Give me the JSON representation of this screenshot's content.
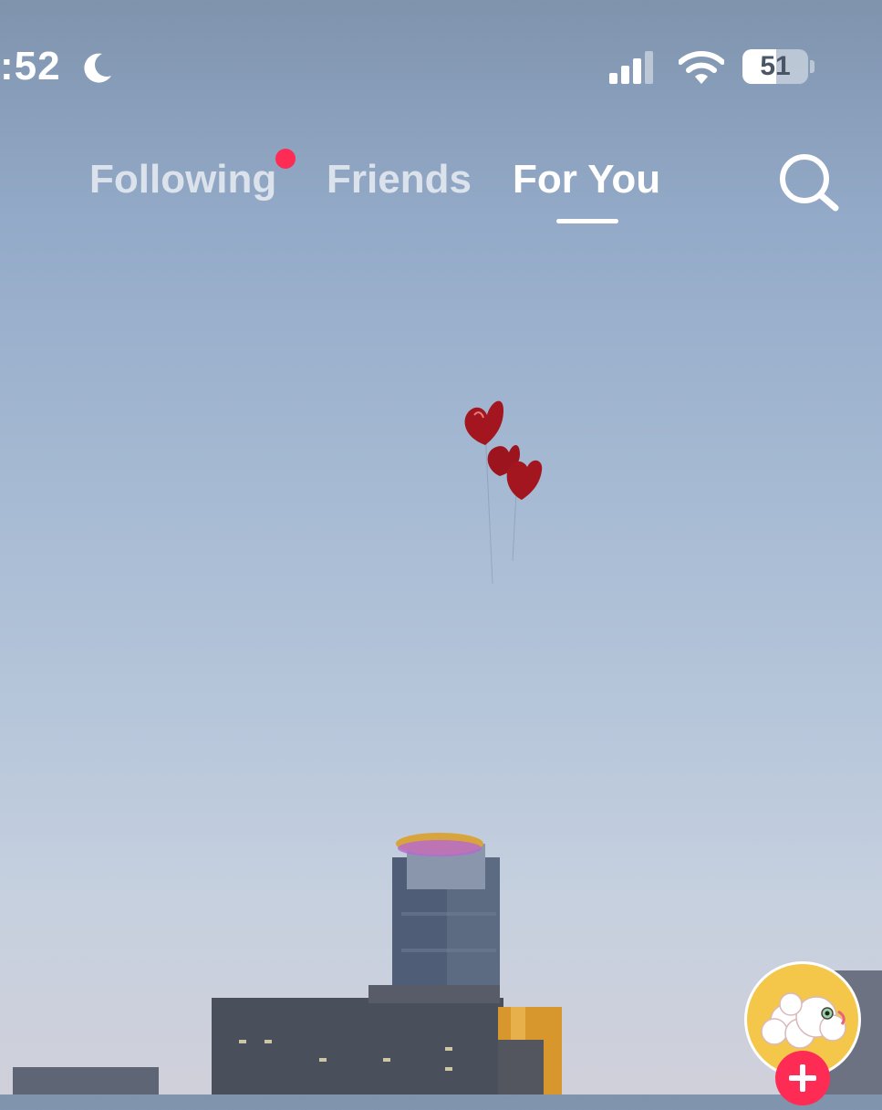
{
  "status_bar": {
    "time": ":52",
    "battery_level": "51",
    "icons": [
      "moon-icon",
      "cellular-signal-icon",
      "wifi-icon",
      "battery-icon"
    ]
  },
  "nav": {
    "tabs": [
      {
        "label": "Following",
        "active": false,
        "notification_dot": true
      },
      {
        "label": "Friends",
        "active": false
      },
      {
        "label": "For You",
        "active": true
      }
    ],
    "search_icon": "search-icon"
  },
  "video": {
    "subject_icons": [
      "heart-balloon-icon"
    ]
  },
  "creator": {
    "avatar_icon": "avatar-image",
    "follow_icon": "plus-icon"
  },
  "colors": {
    "accent": "#fe2c55",
    "tab_active": "#ffffff",
    "avatar_bg": "#f4c74a"
  }
}
